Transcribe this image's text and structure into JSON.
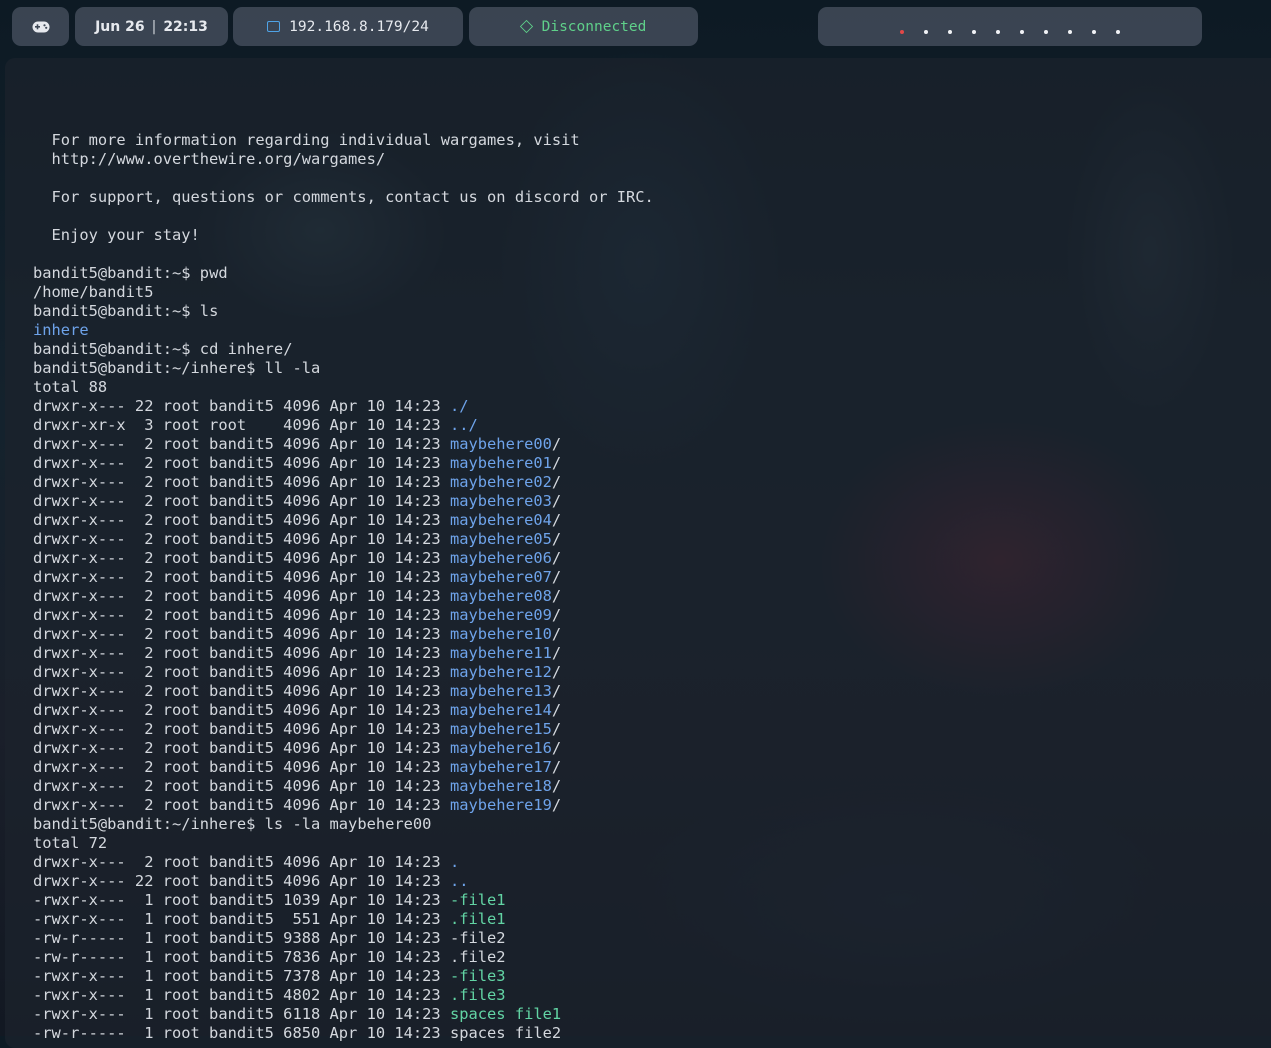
{
  "statusbar": {
    "gamepad_icon": "gamepad-icon",
    "date": "Jun 26",
    "separator": "|",
    "time": "22:13",
    "ip": "192.168.8.179/24",
    "vpn_status": "Disconnected",
    "workspace_count": 10,
    "active_workspace": 0,
    "colors": {
      "accent_blue": "#4fa3e6",
      "vpn_green": "#5fd08a",
      "active_dot": "#e24848"
    }
  },
  "terminal": {
    "banner": [
      "",
      "For more information regarding individual wargames, visit",
      "http://www.overthewire.org/wargames/",
      "",
      "For support, questions or comments, contact us on discord or IRC.",
      "",
      "Enjoy your stay!",
      ""
    ],
    "session": [
      {
        "prompt": "bandit5@bandit:~$ ",
        "cmd": "pwd"
      },
      {
        "out": "/home/bandit5"
      },
      {
        "prompt": "bandit5@bandit:~$ ",
        "cmd": "ls"
      },
      {
        "out": "inhere",
        "kind": "dir"
      },
      {
        "prompt": "bandit5@bandit:~$ ",
        "cmd": "cd inhere/"
      },
      {
        "prompt": "bandit5@bandit:~/inhere$ ",
        "cmd": "ll -la"
      },
      {
        "out": "total 88"
      },
      {
        "meta": "drwxr-x--- 22 root bandit5 4096 Apr 10 14:23 ",
        "name": "./",
        "kind": "dir"
      },
      {
        "meta": "drwxr-xr-x  3 root root    4096 Apr 10 14:23 ",
        "name": "../",
        "kind": "dir"
      },
      {
        "meta": "drwxr-x---  2 root bandit5 4096 Apr 10 14:23 ",
        "name": "maybehere00",
        "kind": "dir",
        "suffix": "/"
      },
      {
        "meta": "drwxr-x---  2 root bandit5 4096 Apr 10 14:23 ",
        "name": "maybehere01",
        "kind": "dir",
        "suffix": "/"
      },
      {
        "meta": "drwxr-x---  2 root bandit5 4096 Apr 10 14:23 ",
        "name": "maybehere02",
        "kind": "dir",
        "suffix": "/"
      },
      {
        "meta": "drwxr-x---  2 root bandit5 4096 Apr 10 14:23 ",
        "name": "maybehere03",
        "kind": "dir",
        "suffix": "/"
      },
      {
        "meta": "drwxr-x---  2 root bandit5 4096 Apr 10 14:23 ",
        "name": "maybehere04",
        "kind": "dir",
        "suffix": "/"
      },
      {
        "meta": "drwxr-x---  2 root bandit5 4096 Apr 10 14:23 ",
        "name": "maybehere05",
        "kind": "dir",
        "suffix": "/"
      },
      {
        "meta": "drwxr-x---  2 root bandit5 4096 Apr 10 14:23 ",
        "name": "maybehere06",
        "kind": "dir",
        "suffix": "/"
      },
      {
        "meta": "drwxr-x---  2 root bandit5 4096 Apr 10 14:23 ",
        "name": "maybehere07",
        "kind": "dir",
        "suffix": "/"
      },
      {
        "meta": "drwxr-x---  2 root bandit5 4096 Apr 10 14:23 ",
        "name": "maybehere08",
        "kind": "dir",
        "suffix": "/"
      },
      {
        "meta": "drwxr-x---  2 root bandit5 4096 Apr 10 14:23 ",
        "name": "maybehere09",
        "kind": "dir",
        "suffix": "/"
      },
      {
        "meta": "drwxr-x---  2 root bandit5 4096 Apr 10 14:23 ",
        "name": "maybehere10",
        "kind": "dir",
        "suffix": "/"
      },
      {
        "meta": "drwxr-x---  2 root bandit5 4096 Apr 10 14:23 ",
        "name": "maybehere11",
        "kind": "dir",
        "suffix": "/"
      },
      {
        "meta": "drwxr-x---  2 root bandit5 4096 Apr 10 14:23 ",
        "name": "maybehere12",
        "kind": "dir",
        "suffix": "/"
      },
      {
        "meta": "drwxr-x---  2 root bandit5 4096 Apr 10 14:23 ",
        "name": "maybehere13",
        "kind": "dir",
        "suffix": "/"
      },
      {
        "meta": "drwxr-x---  2 root bandit5 4096 Apr 10 14:23 ",
        "name": "maybehere14",
        "kind": "dir",
        "suffix": "/"
      },
      {
        "meta": "drwxr-x---  2 root bandit5 4096 Apr 10 14:23 ",
        "name": "maybehere15",
        "kind": "dir",
        "suffix": "/"
      },
      {
        "meta": "drwxr-x---  2 root bandit5 4096 Apr 10 14:23 ",
        "name": "maybehere16",
        "kind": "dir",
        "suffix": "/"
      },
      {
        "meta": "drwxr-x---  2 root bandit5 4096 Apr 10 14:23 ",
        "name": "maybehere17",
        "kind": "dir",
        "suffix": "/"
      },
      {
        "meta": "drwxr-x---  2 root bandit5 4096 Apr 10 14:23 ",
        "name": "maybehere18",
        "kind": "dir",
        "suffix": "/"
      },
      {
        "meta": "drwxr-x---  2 root bandit5 4096 Apr 10 14:23 ",
        "name": "maybehere19",
        "kind": "dir",
        "suffix": "/"
      },
      {
        "prompt": "bandit5@bandit:~/inhere$ ",
        "cmd": "ls -la maybehere00"
      },
      {
        "out": "total 72"
      },
      {
        "meta": "drwxr-x---  2 root bandit5 4096 Apr 10 14:23 ",
        "name": ".",
        "kind": "dir"
      },
      {
        "meta": "drwxr-x--- 22 root bandit5 4096 Apr 10 14:23 ",
        "name": "..",
        "kind": "dir"
      },
      {
        "meta": "-rwxr-x---  1 root bandit5 1039 Apr 10 14:23 ",
        "name": "-file1",
        "kind": "exe"
      },
      {
        "meta": "-rwxr-x---  1 root bandit5  551 Apr 10 14:23 ",
        "name": ".file1",
        "kind": "exe"
      },
      {
        "meta": "-rw-r-----  1 root bandit5 9388 Apr 10 14:23 ",
        "name": "-file2",
        "kind": "plain"
      },
      {
        "meta": "-rw-r-----  1 root bandit5 7836 Apr 10 14:23 ",
        "name": ".file2",
        "kind": "plain"
      },
      {
        "meta": "-rwxr-x---  1 root bandit5 7378 Apr 10 14:23 ",
        "name": "-file3",
        "kind": "exe"
      },
      {
        "meta": "-rwxr-x---  1 root bandit5 4802 Apr 10 14:23 ",
        "name": ".file3",
        "kind": "exe"
      },
      {
        "meta": "-rwxr-x---  1 root bandit5 6118 Apr 10 14:23 ",
        "name": "spaces file1",
        "kind": "exe"
      },
      {
        "meta": "-rw-r-----  1 root bandit5 6850 Apr 10 14:23 ",
        "name": "spaces file2",
        "kind": "plain"
      }
    ]
  }
}
